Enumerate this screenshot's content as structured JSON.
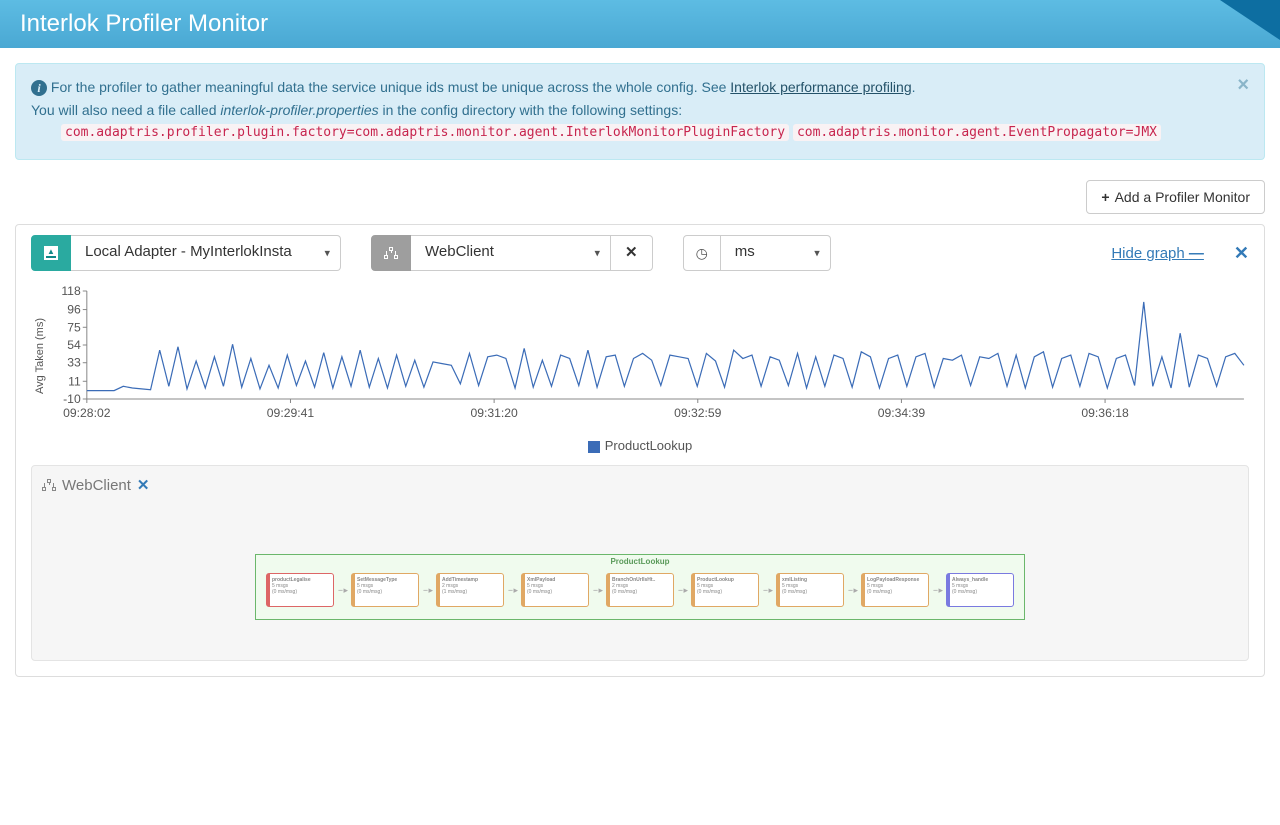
{
  "header": {
    "title": "Interlok Profiler Monitor"
  },
  "alert": {
    "intro": "For the profiler to gather meaningful data the service unique ids must be unique across the whole config. See ",
    "link_text": "Interlok performance profiling",
    "line2_pre": "You will also need a file called ",
    "line2_em": "interlok-profiler.properties",
    "line2_post": " in the config directory with the following settings:",
    "settings": [
      "com.adaptris.profiler.plugin.factory=com.adaptris.monitor.agent.InterlokMonitorPluginFactory",
      "com.adaptris.monitor.agent.EventPropagator=JMX"
    ]
  },
  "buttons": {
    "add_monitor": "Add a Profiler Monitor"
  },
  "controls": {
    "adapter_selected": "Local Adapter - MyInterlokInsta",
    "workflow_selected": "WebClient",
    "unit_selected": "ms",
    "hide_graph": "Hide graph "
  },
  "chart_data": {
    "type": "line",
    "title": "",
    "ylabel": "Avg Taken (ms)",
    "xlabel": "",
    "ylim": [
      -10,
      118
    ],
    "yticks": [
      -10,
      11,
      33,
      54,
      75,
      96,
      118
    ],
    "xticks": [
      "09:28:02",
      "09:29:41",
      "09:31:20",
      "09:32:59",
      "09:34:39",
      "09:36:18"
    ],
    "series": [
      {
        "name": "ProductLookup",
        "values": [
          0,
          0,
          0,
          0,
          5,
          3,
          2,
          1,
          48,
          5,
          52,
          2,
          35,
          3,
          40,
          5,
          55,
          4,
          38,
          2,
          30,
          3,
          42,
          6,
          35,
          4,
          45,
          3,
          40,
          5,
          48,
          4,
          38,
          3,
          42,
          5,
          36,
          4,
          34,
          32,
          30,
          8,
          44,
          6,
          40,
          42,
          38,
          3,
          50,
          4,
          36,
          5,
          42,
          38,
          6,
          48,
          4,
          40,
          42,
          5,
          38,
          44,
          36,
          6,
          42,
          40,
          38,
          5,
          44,
          35,
          4,
          48,
          38,
          42,
          5,
          40,
          36,
          6,
          44,
          3,
          40,
          5,
          42,
          38,
          4,
          46,
          40,
          3,
          38,
          42,
          5,
          40,
          44,
          4,
          38,
          36,
          42,
          6,
          40,
          38,
          44,
          5,
          42,
          3,
          40,
          46,
          4,
          38,
          42,
          5,
          44,
          40,
          3,
          38,
          42,
          6,
          105,
          5,
          40,
          3,
          68,
          4,
          42,
          38,
          5,
          40,
          44,
          30
        ]
      }
    ]
  },
  "diagram": {
    "title": "WebClient",
    "workflow_label": "ProductLookup",
    "nodes": [
      {
        "name": "productLegalise",
        "l2": "5 msgs",
        "l3": "(0 ms/msg)",
        "variant": "red"
      },
      {
        "name": "SetMessageType",
        "l2": "5 msgs",
        "l3": "(0 ms/msg)",
        "variant": "orange"
      },
      {
        "name": "AddTimestamp",
        "l2": "2 msgs",
        "l3": "(1 ms/msg)",
        "variant": "orange"
      },
      {
        "name": "XmlPayload",
        "l2": "5 msgs",
        "l3": "(0 ms/msg)",
        "variant": "orange"
      },
      {
        "name": "BranchOnUrlIsHt..",
        "l2": "2 msgs",
        "l3": "(0 ms/msg)",
        "variant": "orange"
      },
      {
        "name": "ProductLookup",
        "l2": "5 msgs",
        "l3": "(0 ms/msg)",
        "variant": "orange"
      },
      {
        "name": "xmlListing",
        "l2": "5 msgs",
        "l3": "(0 ms/msg)",
        "variant": "orange"
      },
      {
        "name": "LogPayloadResponse",
        "l2": "5 msgs",
        "l3": "(0 ms/msg)",
        "variant": "orange"
      },
      {
        "name": "Always_handle",
        "l2": "5 msgs",
        "l3": "(0 ms/msg)",
        "variant": "blue"
      }
    ]
  }
}
